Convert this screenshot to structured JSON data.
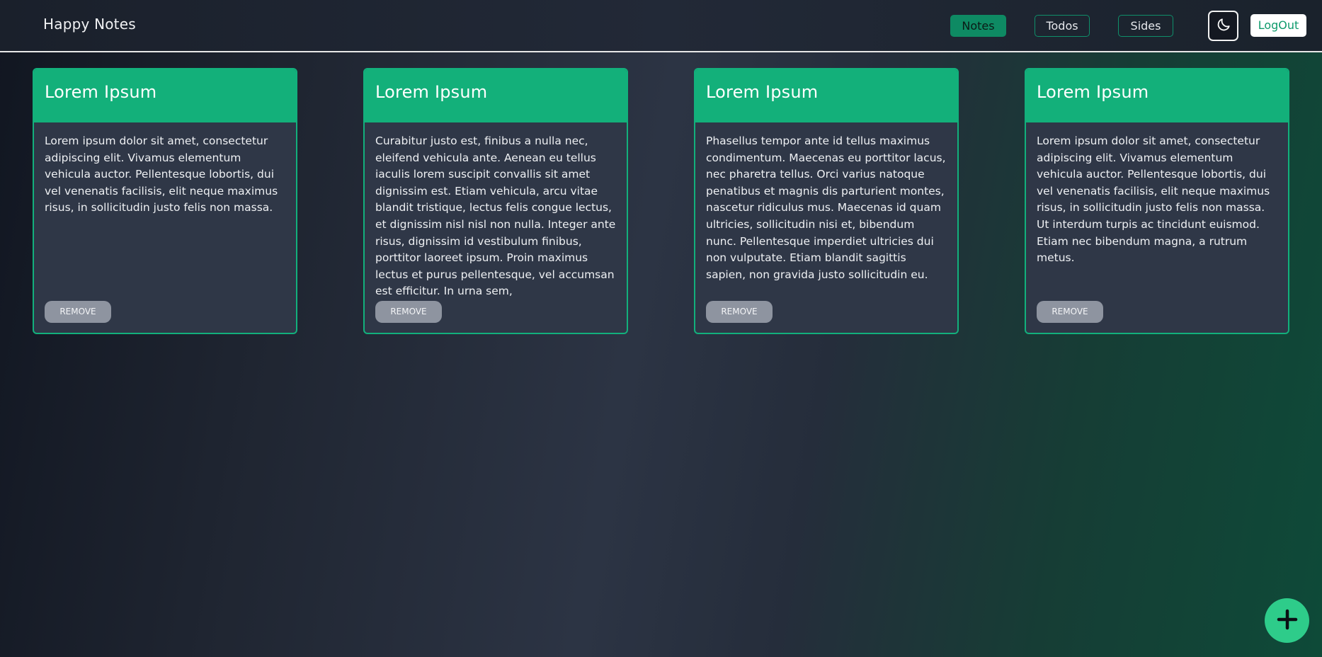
{
  "app": {
    "title": "Happy Notes"
  },
  "nav": {
    "items": [
      {
        "label": "Notes",
        "active": true
      },
      {
        "label": "Todos",
        "active": false
      },
      {
        "label": "Sides",
        "active": false
      }
    ],
    "theme_toggle_icon": "moon-icon",
    "logout_label": "LogOut"
  },
  "notes": [
    {
      "title": "Lorem Ipsum",
      "body": "Lorem ipsum dolor sit amet, consectetur adipiscing elit. Vivamus elementum vehicula auctor. Pellentesque lobortis, dui vel venenatis facilisis, elit neque maximus risus, in sollicitudin justo felis non massa.",
      "remove_label": "REMOVE"
    },
    {
      "title": "Lorem Ipsum",
      "body": "Curabitur justo est, finibus a nulla nec, eleifend vehicula ante. Aenean eu tellus iaculis lorem suscipit convallis sit amet dignissim est. Etiam vehicula, arcu vitae blandit tristique, lectus felis congue lectus, et dignissim nisl nisl non nulla. Integer ante risus, dignissim id vestibulum finibus, porttitor laoreet ipsum. Proin maximus lectus et purus pellentesque, vel accumsan est efficitur. In urna sem,",
      "remove_label": "REMOVE"
    },
    {
      "title": "Lorem Ipsum",
      "body": "Phasellus tempor ante id tellus maximus condimentum. Maecenas eu porttitor lacus, nec pharetra tellus. Orci varius natoque penatibus et magnis dis parturient montes, nascetur ridiculus mus. Maecenas id quam ultricies, sollicitudin nisi et, bibendum nunc. Pellentesque imperdiet ultricies dui non vulputate. Etiam blandit sagittis sapien, non gravida justo sollicitudin eu.",
      "remove_label": "REMOVE"
    },
    {
      "title": "Lorem Ipsum",
      "body": "Lorem ipsum dolor sit amet, consectetur adipiscing elit. Vivamus elementum vehicula auctor. Pellentesque lobortis, dui vel venenatis facilisis, elit neque maximus risus, in sollicitudin justo felis non massa. Ut interdum turpis ac tincidunt euismod. Etiam nec bibendum magna, a rutrum metus.",
      "remove_label": "REMOVE"
    }
  ],
  "fab": {
    "icon": "plus-icon"
  },
  "colors": {
    "accent": "#13b07a",
    "nav_active": "#0e8a63",
    "card_body": "#2f3747",
    "remove_button": "#8e94a0",
    "fab": "#2ecc8a"
  }
}
